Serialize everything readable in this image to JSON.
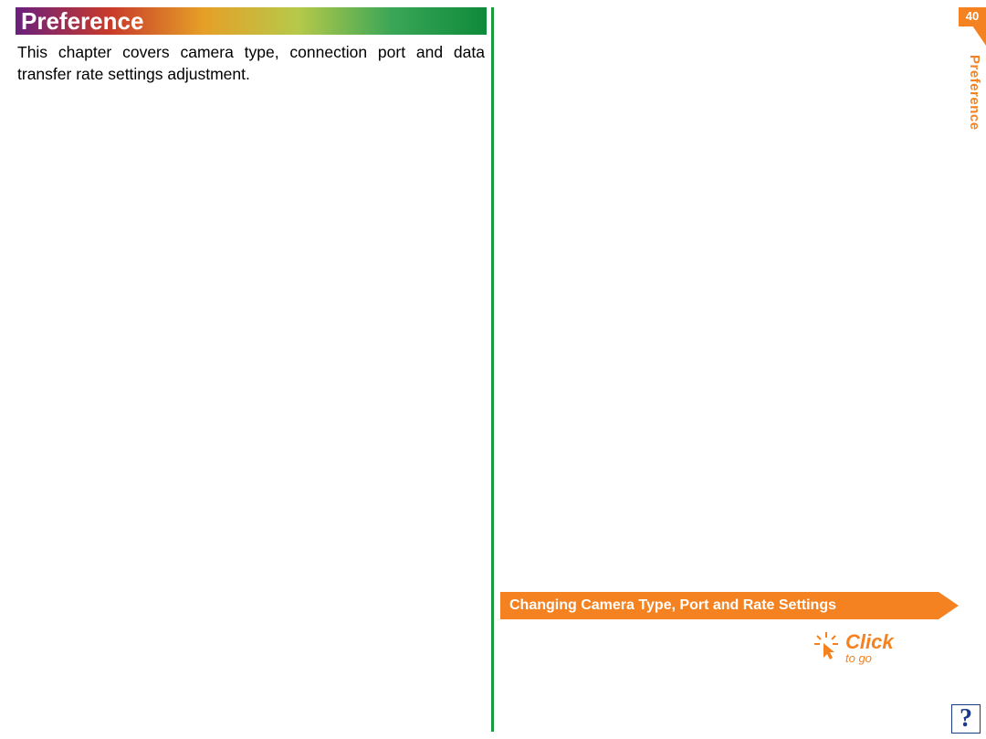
{
  "header": {
    "title": "Preference"
  },
  "body": {
    "paragraph": "This chapter covers camera type, connection port and data transfer rate settings adjustment."
  },
  "page": {
    "number": "40",
    "side_label": "Preference"
  },
  "banner": {
    "text": "Changing Camera Type, Port and Rate Settings"
  },
  "cta": {
    "word": "Click",
    "sub": "to go"
  },
  "help": {
    "symbol": "?"
  }
}
